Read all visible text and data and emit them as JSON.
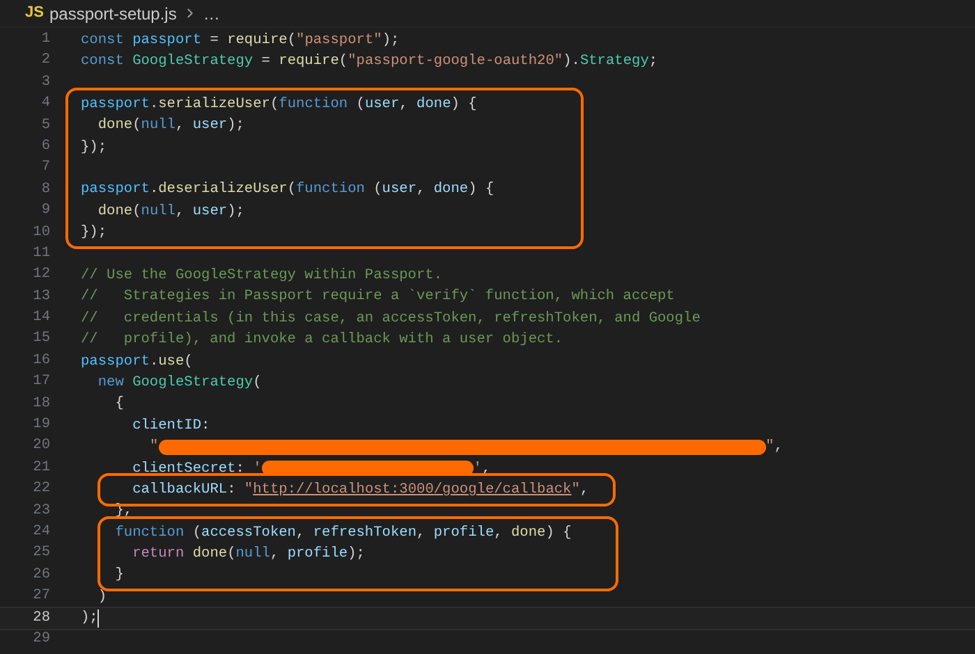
{
  "breadcrumb": {
    "file_badge": "JS",
    "file": "passport-setup.js",
    "more": "…"
  },
  "blocks": [
    {
      "kind": "plain",
      "lines": [
        {
          "number": "1",
          "current": false,
          "tokens": [
            {
              "kind": "keyword",
              "text": "const "
            },
            {
              "kind": "constant",
              "text": "passport"
            },
            {
              "kind": "punct",
              "text": " = "
            },
            {
              "kind": "function",
              "text": "require"
            },
            {
              "kind": "punct",
              "text": "("
            },
            {
              "kind": "string",
              "text": "\"passport\""
            },
            {
              "kind": "punct",
              "text": ");"
            }
          ]
        },
        {
          "number": "2",
          "current": false,
          "tokens": [
            {
              "kind": "keyword",
              "text": "const "
            },
            {
              "kind": "class",
              "text": "GoogleStrategy"
            },
            {
              "kind": "punct",
              "text": " = "
            },
            {
              "kind": "function",
              "text": "require"
            },
            {
              "kind": "punct",
              "text": "("
            },
            {
              "kind": "string",
              "text": "\"passport-google-oauth20\""
            },
            {
              "kind": "punct",
              "text": ")."
            },
            {
              "kind": "class",
              "text": "Strategy"
            },
            {
              "kind": "punct",
              "text": ";"
            }
          ]
        },
        {
          "number": "3",
          "current": false
        }
      ]
    },
    {
      "kind": "highlight",
      "lines": [
        {
          "number": "4",
          "current": false,
          "tokens": [
            {
              "kind": "constant",
              "text": "passport"
            },
            {
              "kind": "punct",
              "text": "."
            },
            {
              "kind": "function",
              "text": "serializeUser"
            },
            {
              "kind": "punct",
              "text": "("
            },
            {
              "kind": "keyword",
              "text": "function"
            },
            {
              "kind": "punct",
              "text": " ("
            },
            {
              "kind": "variable",
              "text": "user"
            },
            {
              "kind": "punct",
              "text": ", "
            },
            {
              "kind": "variable",
              "text": "done"
            },
            {
              "kind": "punct",
              "text": ") {"
            }
          ]
        },
        {
          "number": "5",
          "current": false,
          "tokens": [
            {
              "kind": "function",
              "text": "  done"
            },
            {
              "kind": "punct",
              "text": "("
            },
            {
              "kind": "keyword",
              "text": "null"
            },
            {
              "kind": "punct",
              "text": ", "
            },
            {
              "kind": "variable",
              "text": "user"
            },
            {
              "kind": "punct",
              "text": ");"
            }
          ]
        },
        {
          "number": "6",
          "current": false,
          "tokens": [
            {
              "kind": "punct",
              "text": "});"
            }
          ]
        },
        {
          "number": "7",
          "current": false
        },
        {
          "number": "8",
          "current": false,
          "tokens": [
            {
              "kind": "constant",
              "text": "passport"
            },
            {
              "kind": "punct",
              "text": "."
            },
            {
              "kind": "function",
              "text": "deserializeUser"
            },
            {
              "kind": "punct",
              "text": "("
            },
            {
              "kind": "keyword",
              "text": "function"
            },
            {
              "kind": "punct",
              "text": " ("
            },
            {
              "kind": "variable",
              "text": "user"
            },
            {
              "kind": "punct",
              "text": ", "
            },
            {
              "kind": "variable",
              "text": "done"
            },
            {
              "kind": "punct",
              "text": ") {"
            }
          ]
        },
        {
          "number": "9",
          "current": false,
          "tokens": [
            {
              "kind": "function",
              "text": "  done"
            },
            {
              "kind": "punct",
              "text": "("
            },
            {
              "kind": "keyword",
              "text": "null"
            },
            {
              "kind": "punct",
              "text": ", "
            },
            {
              "kind": "variable",
              "text": "user"
            },
            {
              "kind": "punct",
              "text": ");"
            }
          ]
        },
        {
          "number": "10",
          "current": false,
          "tokens": [
            {
              "kind": "punct",
              "text": "});"
            }
          ]
        }
      ]
    },
    {
      "kind": "plain",
      "lines": [
        {
          "number": "11",
          "current": false
        },
        {
          "number": "12",
          "current": false,
          "tokens": [
            {
              "kind": "comment",
              "text": "// Use the GoogleStrategy within Passport."
            }
          ]
        },
        {
          "number": "13",
          "current": false,
          "tokens": [
            {
              "kind": "comment",
              "text": "//   Strategies in Passport require a `verify` function, which accept"
            }
          ]
        },
        {
          "number": "14",
          "current": false,
          "tokens": [
            {
              "kind": "comment",
              "text": "//   credentials (in this case, an accessToken, refreshToken, and Google"
            }
          ]
        },
        {
          "number": "15",
          "current": false,
          "tokens": [
            {
              "kind": "comment",
              "text": "//   profile), and invoke a callback with a user object."
            }
          ]
        },
        {
          "number": "16",
          "current": false,
          "tokens": [
            {
              "kind": "constant",
              "text": "passport"
            },
            {
              "kind": "punct",
              "text": "."
            },
            {
              "kind": "function",
              "text": "use"
            },
            {
              "kind": "punct",
              "text": "("
            }
          ]
        },
        {
          "number": "17",
          "current": false,
          "tokens": [
            {
              "kind": "keyword",
              "text": "  new "
            },
            {
              "kind": "class",
              "text": "GoogleStrategy"
            },
            {
              "kind": "punct",
              "text": "("
            }
          ]
        },
        {
          "number": "18",
          "current": false,
          "tokens": [
            {
              "kind": "punct",
              "text": "    {"
            }
          ]
        },
        {
          "number": "19",
          "current": false,
          "tokens": [
            {
              "kind": "variable",
              "text": "      clientID"
            },
            {
              "kind": "punct",
              "text": ":"
            }
          ]
        },
        {
          "number": "20",
          "current": false,
          "tokens": [
            {
              "kind": "string",
              "text": "        \""
            },
            {
              "kind": "redaction"
            },
            {
              "kind": "string",
              "text": "\""
            },
            {
              "kind": "punct",
              "text": ","
            }
          ]
        },
        {
          "number": "21",
          "current": false,
          "tokens": [
            {
              "kind": "variable",
              "text": "      clientSecret"
            },
            {
              "kind": "punct",
              "text": ": "
            },
            {
              "kind": "string",
              "text": "'"
            },
            {
              "kind": "redaction"
            },
            {
              "kind": "string",
              "text": "'"
            },
            {
              "kind": "punct",
              "text": ","
            }
          ]
        }
      ]
    },
    {
      "kind": "highlight",
      "lines": [
        {
          "number": "22",
          "current": false,
          "tokens": [
            {
              "kind": "variable",
              "text": "      callbackURL"
            },
            {
              "kind": "punct",
              "text": ": "
            },
            {
              "kind": "string",
              "text": "\""
            },
            {
              "kind": "link",
              "text": "http://localhost:3000/google/callback"
            },
            {
              "kind": "string",
              "text": "\""
            },
            {
              "kind": "punct",
              "text": ","
            }
          ]
        }
      ]
    },
    {
      "kind": "plain",
      "lines": [
        {
          "number": "23",
          "current": false,
          "tokens": [
            {
              "kind": "punct",
              "text": "    },"
            }
          ]
        }
      ]
    },
    {
      "kind": "highlight",
      "lines": [
        {
          "number": "24",
          "current": false,
          "tokens": [
            {
              "kind": "keyword",
              "text": "    function"
            },
            {
              "kind": "punct",
              "text": " ("
            },
            {
              "kind": "variable",
              "text": "accessToken"
            },
            {
              "kind": "punct",
              "text": ", "
            },
            {
              "kind": "variable",
              "text": "refreshToken"
            },
            {
              "kind": "punct",
              "text": ", "
            },
            {
              "kind": "variable",
              "text": "profile"
            },
            {
              "kind": "punct",
              "text": ", "
            },
            {
              "kind": "function",
              "text": "done"
            },
            {
              "kind": "punct",
              "text": ") {"
            }
          ]
        },
        {
          "number": "25",
          "current": false,
          "tokens": [
            {
              "kind": "control",
              "text": "      return "
            },
            {
              "kind": "function",
              "text": "done"
            },
            {
              "kind": "punct",
              "text": "("
            },
            {
              "kind": "keyword",
              "text": "null"
            },
            {
              "kind": "punct",
              "text": ", "
            },
            {
              "kind": "variable",
              "text": "profile"
            },
            {
              "kind": "punct",
              "text": ");"
            }
          ]
        },
        {
          "number": "26",
          "current": false,
          "tokens": [
            {
              "kind": "punct",
              "text": "    }"
            }
          ]
        }
      ]
    },
    {
      "kind": "plain",
      "lines": [
        {
          "number": "27",
          "current": false,
          "tokens": [
            {
              "kind": "punct",
              "text": "  )"
            }
          ]
        },
        {
          "number": "28",
          "current": true,
          "tokens": [
            {
              "kind": "punct",
              "text": ");"
            }
          ]
        },
        {
          "number": "29",
          "current": false
        }
      ]
    }
  ]
}
